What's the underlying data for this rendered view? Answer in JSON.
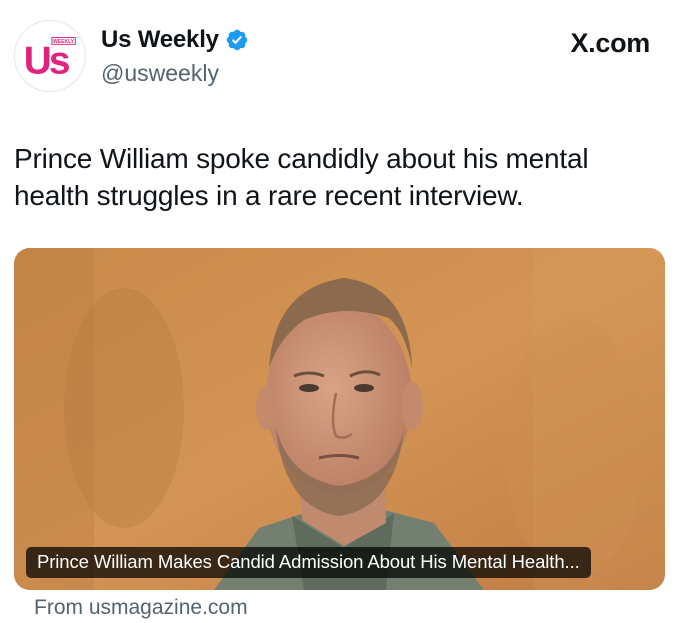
{
  "account": {
    "display_name": "Us Weekly",
    "handle": "@usweekly",
    "logo_text": "Us",
    "logo_badge": "WEEKLY",
    "verified_icon": "verified-badge-icon"
  },
  "platform": {
    "label": "X.com"
  },
  "tweet": {
    "text": "Prince William spoke candidly about his mental health struggles in a rare recent interview."
  },
  "link_card": {
    "image": "portrait-photo",
    "title": "Prince William Makes Candid Admission About His Mental Health...",
    "source": "From usmagazine.com"
  },
  "colors": {
    "brand_pink": "#e2237e",
    "verified_blue": "#1d9bf0",
    "text_primary": "#0f1419",
    "text_secondary": "#536471"
  }
}
